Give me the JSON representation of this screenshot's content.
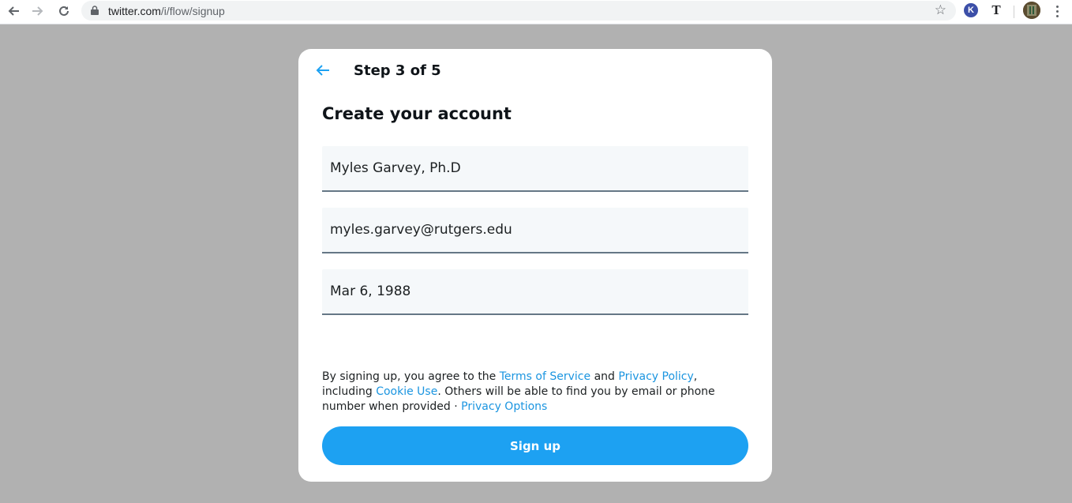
{
  "browser": {
    "url_host": "twitter.com",
    "url_path": "/i/flow/signup",
    "extensions": [
      {
        "name": "k-extension-icon",
        "glyph": "K"
      },
      {
        "name": "t-extension-icon",
        "glyph": "T"
      }
    ]
  },
  "signup": {
    "step_label": "Step 3 of 5",
    "title": "Create your account",
    "name_value": "Myles Garvey, Ph.D",
    "email_value": "myles.garvey@rutgers.edu",
    "dob_value": "Mar 6, 1988",
    "legal": {
      "prefix": "By signing up, you agree to the ",
      "terms_link": "Terms of Service",
      "and": " and ",
      "privacy_link": "Privacy Policy",
      "including": ", including ",
      "cookie_link": "Cookie Use",
      "middle": ". Others will be able to find you by email or phone number when provided · ",
      "privacy_options_link": "Privacy Options"
    },
    "submit_label": "Sign up"
  },
  "colors": {
    "accent": "#1da1f2",
    "link": "#1b95e0",
    "backdrop": "#b1b1b1",
    "field_bg": "#f5f8fa"
  }
}
